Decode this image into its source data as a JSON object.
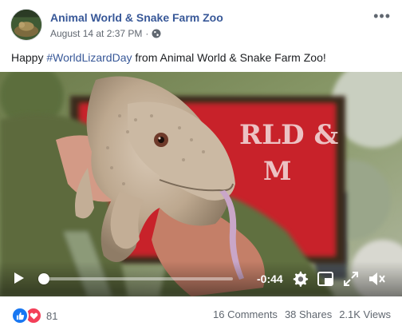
{
  "post": {
    "page_name": "Animal World & Snake Farm Zoo",
    "timestamp": "August 14 at 2:37 PM",
    "meta_separator": "·",
    "privacy_icon": "globe-icon",
    "more_icon": "more-icon",
    "text_before": "Happy ",
    "hashtag": "#WorldLizardDay",
    "text_after": " from Animal World & Snake Farm Zoo!"
  },
  "video": {
    "time_remaining": "-0:44",
    "progress": 0.03,
    "sign_text_1": "RLD &",
    "sign_text_2": "M",
    "icons": {
      "play": "play-icon",
      "settings": "gear-icon",
      "pip": "picture-in-picture-icon",
      "fullscreen": "fullscreen-icon",
      "volume": "volume-muted-icon"
    }
  },
  "footer": {
    "reaction_count": "81",
    "comments": "16 Comments",
    "shares": "38 Shares",
    "views": "2.1K Views"
  },
  "colors": {
    "link": "#385898",
    "like": "#1877f2",
    "love": "#f33e58",
    "muted_text": "#606770"
  }
}
